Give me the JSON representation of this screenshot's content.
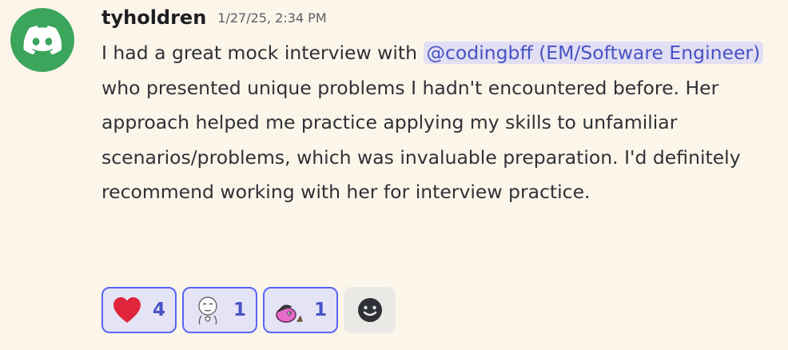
{
  "message": {
    "username": "tyholdren",
    "timestamp": "1/27/25, 2:34 PM",
    "avatar_icon": "discord-logo-icon",
    "avatar_color": "#3ba55c",
    "text_before_mention": "I had a great mock interview with ",
    "mention": "@codingbff (EM/Software Engineer)",
    "text_after_mention": " who presented unique problems I hadn't encountered before. Her approach helped me practice applying my skills to unfamiliar scenarios/problems, which was invaluable preparation. I'd definitely recommend working with her for interview practice."
  },
  "reactions": [
    {
      "emoji": "heart-icon",
      "count": "4"
    },
    {
      "emoji": "thinking-face-sketch-icon",
      "count": "1"
    },
    {
      "emoji": "pink-creature-emoji-icon",
      "count": "1"
    }
  ],
  "add_reaction": {
    "icon": "add-reaction-smiley-icon"
  },
  "colors": {
    "background": "#fcf5ea",
    "mention_bg": "#e2def3",
    "mention_text": "#4752c4",
    "reaction_border": "#5865f2",
    "reaction_bg": "#e5e3f6",
    "heart": "#e0243b"
  }
}
